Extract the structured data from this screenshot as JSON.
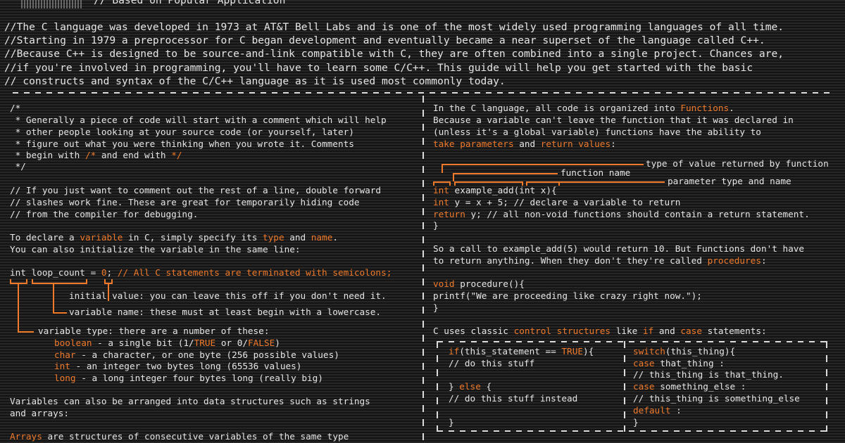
{
  "header": {
    "subtitle": "// Based on Popular Application"
  },
  "intro": [
    "//The C language was developed in 1973 at AT&T Bell Labs and is one of the most widely used programming languages of all time.",
    "//Starting in 1979 a preprocessor for C began development and eventually became a near superset of the language called C++.",
    "//Because C++ is designed to be source-and-link compatible with C, they are often combined into a single project. Chances are,",
    "//if you're involved in programming, you'll have to learn some C/C++. This guide will help you get started with the basic",
    "// constructs and syntax of the C/C++ language as it is used most commonly today."
  ],
  "left": {
    "comment_block": [
      "/*",
      " * Generally a piece of code will start with a comment which will help",
      " * other people looking at your source code (or yourself, later)",
      " * figure out what you were thinking when you wrote it. Comments",
      " * begin with ",
      "/*",
      " and end with ",
      "*/",
      " */"
    ],
    "line_comment": [
      "// If you just want to comment out the rest of a line, double forward",
      "// slashes work fine. These are great for temporarily hiding code",
      "// from the compiler for debugging."
    ],
    "declare": {
      "p1": "To declare a ",
      "w1": "variable",
      "p2": " in C, simply specify its ",
      "w2": "type",
      "p3": " and ",
      "w3": "name",
      "p4": ".",
      "line2": "You can also initialize the variable in the same line:"
    },
    "code": {
      "pre": "int loop_count = ",
      "val": "0",
      "semi": ";",
      "comment": " // All C statements are terminated with semicolons;"
    },
    "notes": {
      "initial": "initial value: you can leave this off if you don't need it.",
      "name": "variable name: these must at least begin with a lowercase.",
      "type": "variable type: there are a number of these:"
    },
    "types": [
      {
        "kw": "boolean",
        "desc": " - a single bit (1/",
        "t": "TRUE",
        "mid": " or 0/",
        "f": "FALSE",
        "end": ")"
      },
      {
        "kw": "char",
        "desc": " - a character, or one byte (256 possible values)"
      },
      {
        "kw": "int",
        "desc": " - an integer two bytes long (65536 values)"
      },
      {
        "kw": "long",
        "desc": " - a long integer four bytes long (really big)"
      }
    ],
    "structures": [
      "Variables can also be arranged into data structures such as strings",
      "and arrays:"
    ],
    "arrays": {
      "kw": "Arrays",
      "rest": " are structures of consecutive variables of the same type"
    }
  },
  "right": {
    "fn_intro": {
      "l1a": "In the C language, all code is organized into ",
      "l1b": "Functions",
      "l1c": ".",
      "l2": "Because a variable can't leave the function that it was declared in",
      "l3": "(unless it's a global variable) functions have the ability to",
      "l4a": "take parameters",
      "l4b": " and ",
      "l4c": "return values",
      "l4d": ":"
    },
    "labels": {
      "ret": "type of value returned by function",
      "fname": "function name",
      "param": "parameter type and name"
    },
    "fn_code": [
      {
        "kw": "int",
        "rest": " example_add(int x){"
      },
      {
        "kw": "int",
        "rest": " y = x + 5; // declare a variable to return"
      },
      {
        "kw": "return",
        "rest": " y; // all non-void functions should contain a return statement."
      },
      {
        "kw": "",
        "rest": "}"
      }
    ],
    "call": {
      "l1": "So a call to example_add(5) would return 10. But Functions don't have",
      "l2a": "to return anything. When they don't they're called ",
      "l2b": "procedures",
      "l2c": ":"
    },
    "proc_code": [
      {
        "kw": "void",
        "rest": " procedure(){"
      },
      {
        "kw": "",
        "rest": "printf(\"We are proceeding like crazy right now.\");"
      },
      {
        "kw": "",
        "rest": "}"
      }
    ],
    "control": {
      "a": "C uses classic ",
      "b": "control structures",
      "c": " like ",
      "d": "if",
      "e": " and ",
      "f": "case",
      "g": " statements:"
    },
    "if_code": {
      "kw_if": "if",
      "cond1": "(this_statement == ",
      "kw_true": "TRUE",
      "cond2": "){",
      "l2": "// do this stuff",
      "l4a": "} ",
      "kw_else": "else",
      "l4b": " {",
      "l5": "// do this stuff instead",
      "l7": "}"
    },
    "switch_code": {
      "kw_switch": "switch",
      "l1": "(this_thing){",
      "kw_case1": "case",
      "l2": " that_thing :",
      "l3": "// this_thing is that_thing.",
      "kw_case2": "case",
      "l4": " something_else :",
      "l5": "// this_thing is something_else",
      "kw_default": "default",
      "l6": " :",
      "l7": "}"
    }
  },
  "colors": {
    "accent": "#f07a2a",
    "text": "#e6e6e6",
    "background": "#1a1a1a"
  }
}
